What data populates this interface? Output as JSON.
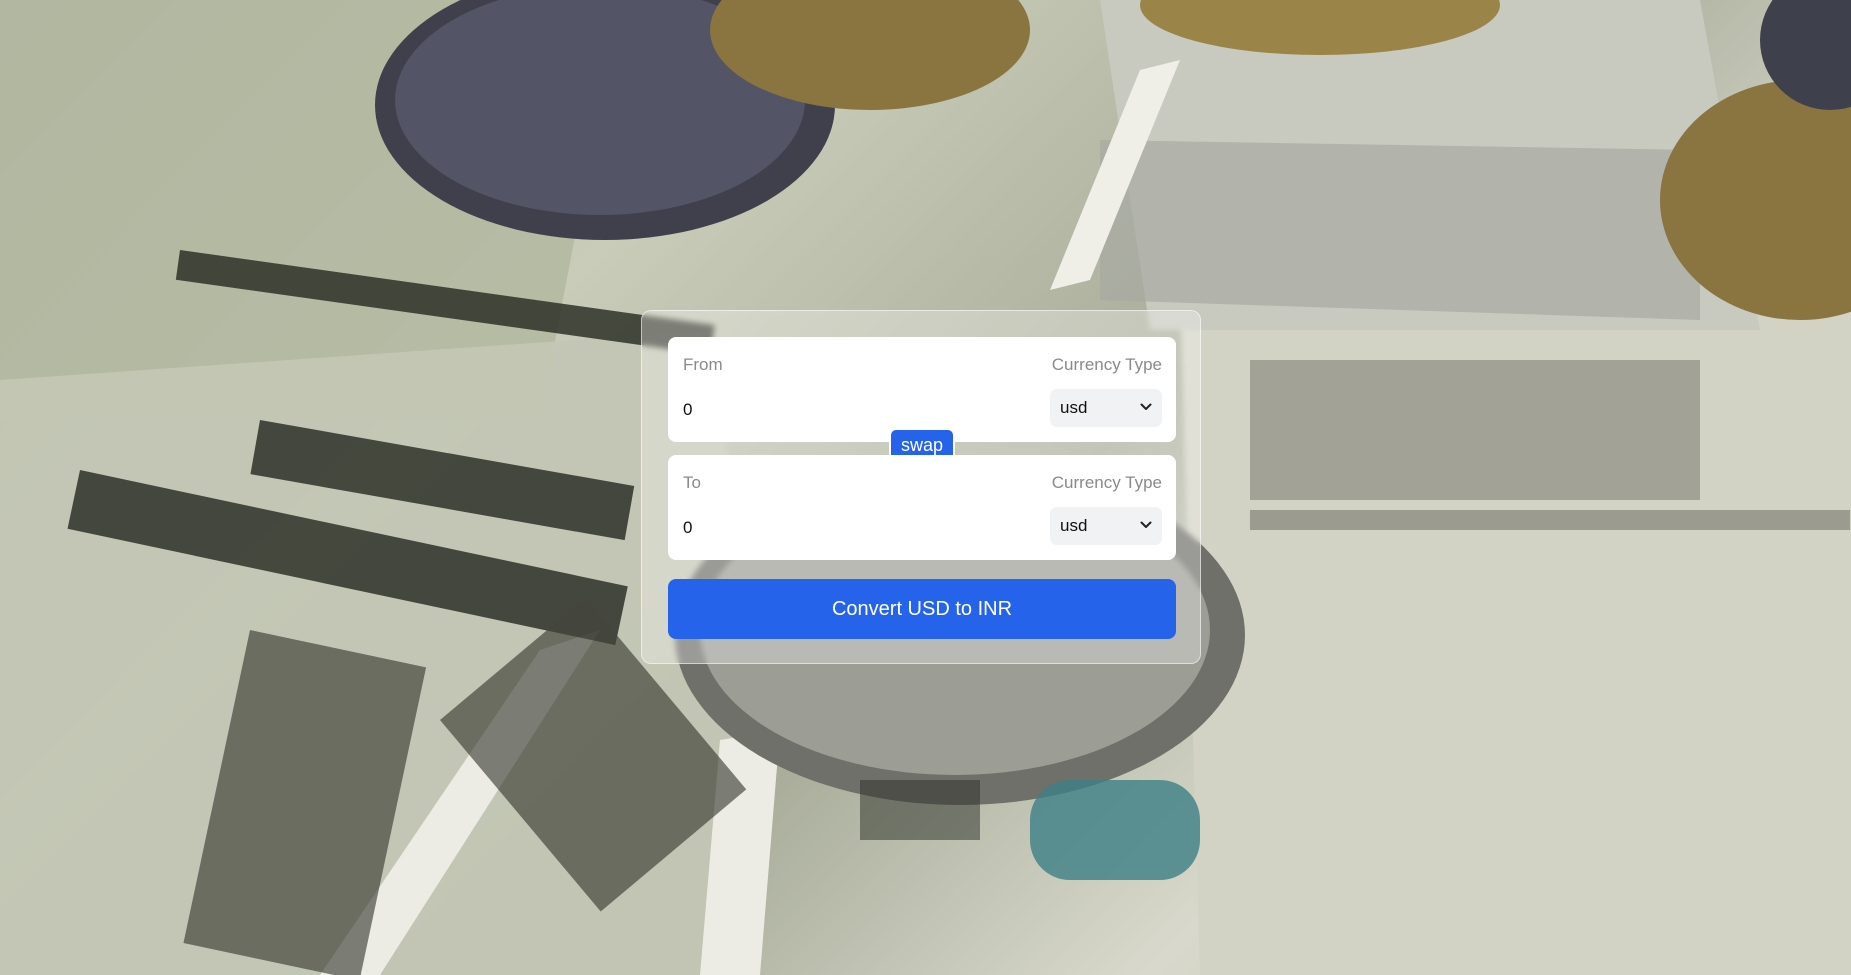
{
  "converter": {
    "from": {
      "label": "From",
      "currency_label": "Currency Type",
      "amount": "0",
      "currency": "usd"
    },
    "swap_label": "swap",
    "to": {
      "label": "To",
      "currency_label": "Currency Type",
      "amount": "0",
      "currency": "usd"
    },
    "convert_label": "Convert USD to INR"
  },
  "colors": {
    "accent": "#2563eb",
    "field_bg": "#ffffff",
    "select_bg": "#f1f2f4"
  },
  "icons": {
    "select_chevron": "chevron-down-icon"
  }
}
